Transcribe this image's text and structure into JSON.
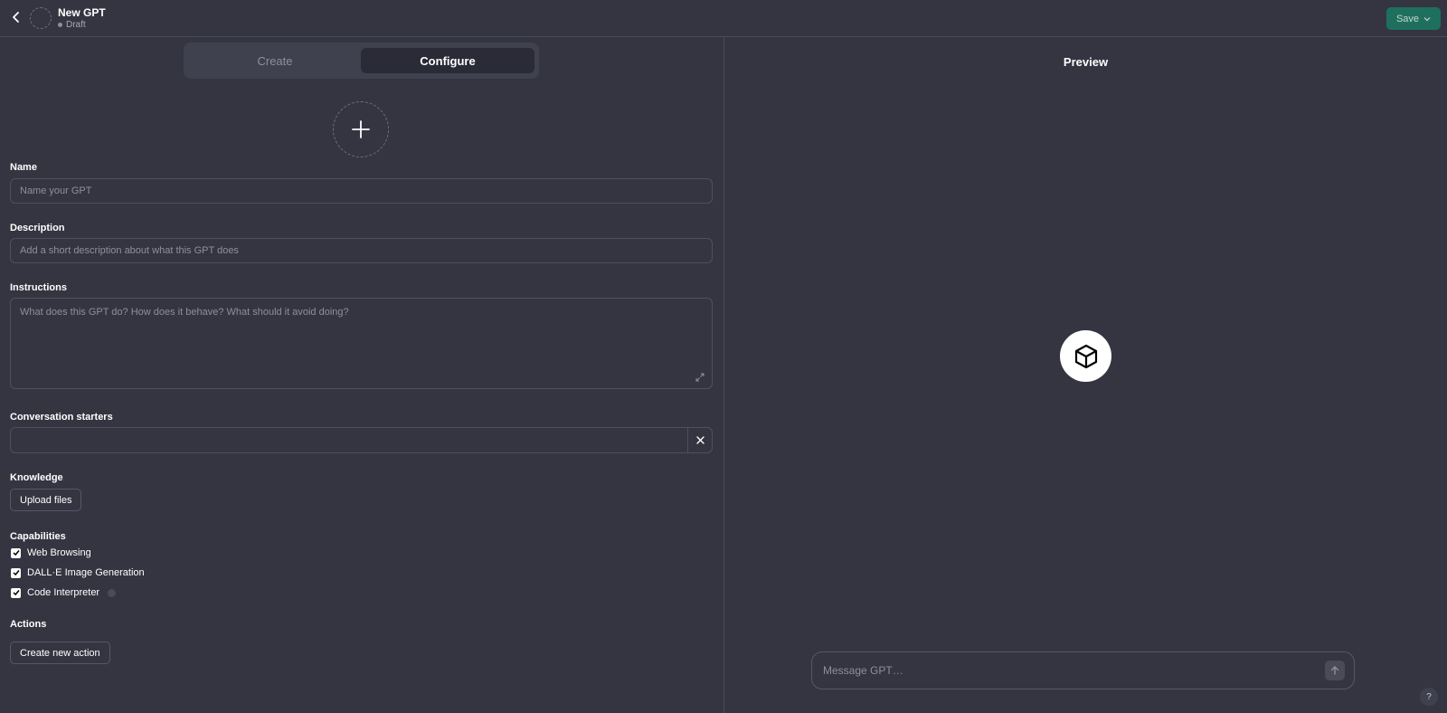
{
  "header": {
    "title": "New GPT",
    "status": "Draft",
    "save_label": "Save"
  },
  "tabs": [
    {
      "label": "Create",
      "active": false
    },
    {
      "label": "Configure",
      "active": true
    }
  ],
  "form": {
    "name": {
      "label": "Name",
      "placeholder": "Name your GPT",
      "value": ""
    },
    "description": {
      "label": "Description",
      "placeholder": "Add a short description about what this GPT does",
      "value": ""
    },
    "instructions": {
      "label": "Instructions",
      "placeholder": "What does this GPT do? How does it behave? What should it avoid doing?",
      "value": ""
    },
    "conversation_starters": {
      "label": "Conversation starters",
      "value": ""
    },
    "knowledge": {
      "label": "Knowledge",
      "upload_label": "Upload files"
    },
    "capabilities": {
      "label": "Capabilities",
      "items": [
        {
          "label": "Web Browsing",
          "checked": true
        },
        {
          "label": "DALL·E Image Generation",
          "checked": true
        },
        {
          "label": "Code Interpreter",
          "checked": true
        }
      ]
    },
    "actions": {
      "label": "Actions",
      "create_label": "Create new action"
    }
  },
  "preview": {
    "title": "Preview",
    "message_placeholder": "Message GPT…"
  },
  "help_label": "?",
  "colors": {
    "background": "#343541",
    "save_button": "#1f6f5e",
    "border": "#4f505c"
  }
}
